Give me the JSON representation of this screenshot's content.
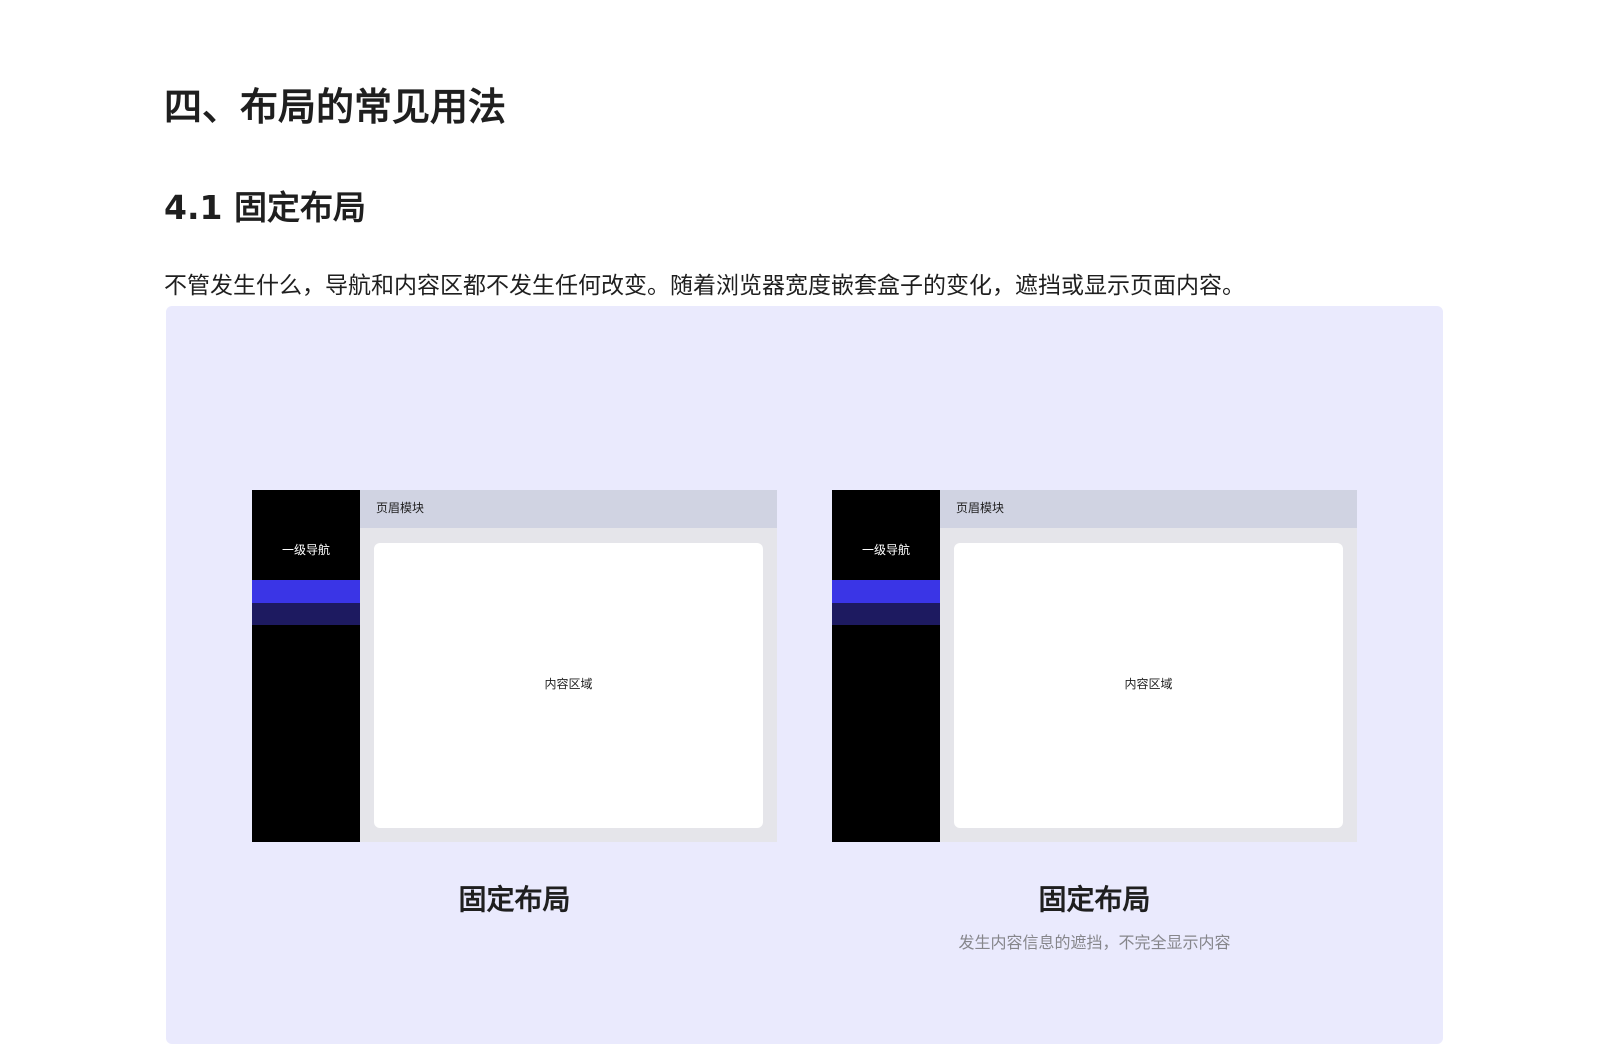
{
  "heading": "四、布局的常见用法",
  "subheading": "4.1 固定布局",
  "paragraph": "不管发生什么，导航和内容区都不发生任何改变。随着浏览器宽度嵌套盒子的变化，遮挡或显示页面内容。",
  "colors": {
    "figure_bg": "#eaeafd",
    "nav_bg": "#000000",
    "nav_active": "#3a35e6",
    "nav_sub": "#1d1a60",
    "header_bg": "#d0d3e2",
    "frame_bg": "#e5e5ea"
  },
  "figure": {
    "left_mock": {
      "nav_label": "一级导航",
      "header_label": "页眉模块",
      "content_label": "内容区域",
      "caption": "固定布局"
    },
    "right_mock": {
      "nav_label": "一级导航",
      "header_label": "页眉模块",
      "content_label": "内容区域",
      "caption": "固定布局",
      "subcaption": "发生内容信息的遮挡，不完全显示内容"
    }
  }
}
